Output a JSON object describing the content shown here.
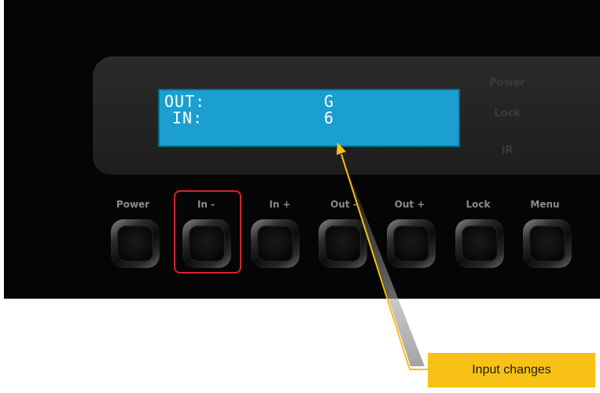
{
  "lcd": {
    "out_label": "OUT:",
    "out_value": "G",
    "in_label": "IN:",
    "in_value": "6",
    "color": "#1a9fd0"
  },
  "indicators": {
    "power": "Power",
    "lock": "Lock",
    "ir": "IR"
  },
  "buttons": [
    {
      "label": "Power",
      "icon": "power-button"
    },
    {
      "label": "In -",
      "icon": "input-down-button"
    },
    {
      "label": "In +",
      "icon": "input-up-button"
    },
    {
      "label": "Out -",
      "icon": "output-down-button"
    },
    {
      "label": "Out +",
      "icon": "output-up-button"
    },
    {
      "label": "Lock",
      "icon": "lock-button"
    },
    {
      "label": "Menu",
      "icon": "menu-button"
    }
  ],
  "callout": {
    "text": "Input changes",
    "color": "#f8c115",
    "highlight_color": "#d6252b"
  }
}
